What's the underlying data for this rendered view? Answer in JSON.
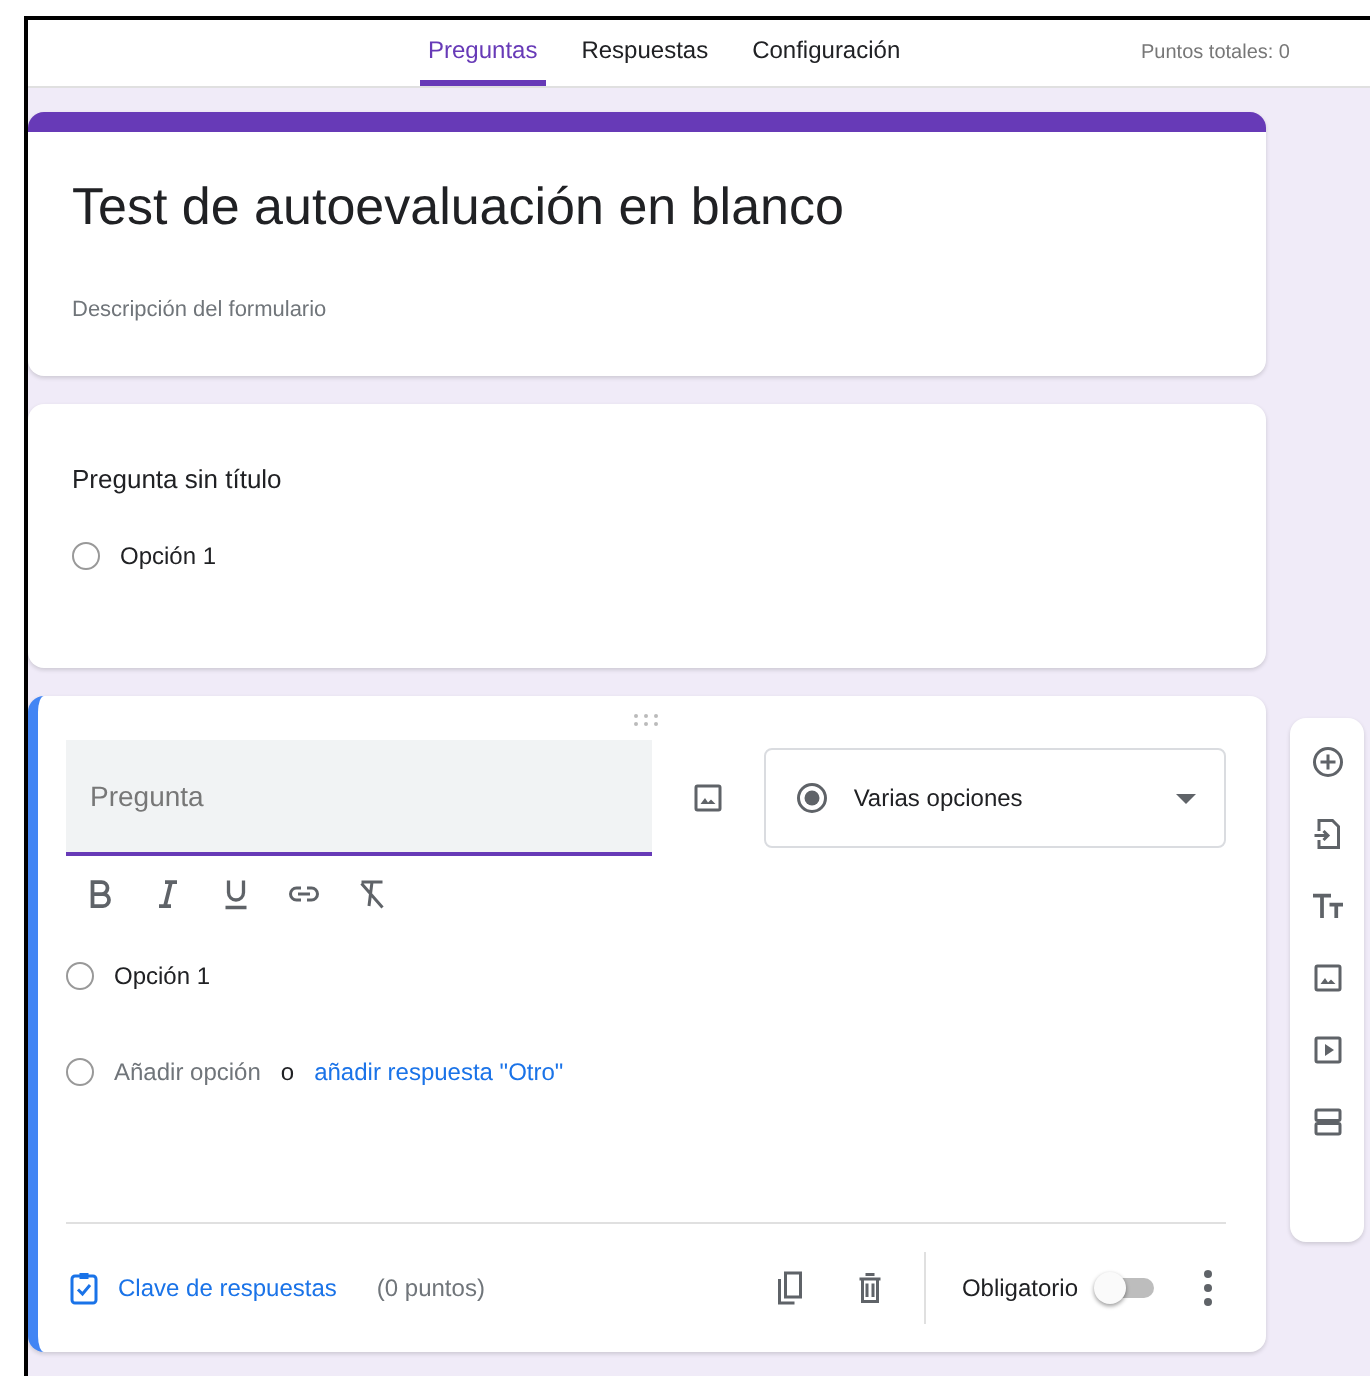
{
  "tabs": [
    {
      "label": "Preguntas",
      "selected": true
    },
    {
      "label": "Respuestas",
      "selected": false
    },
    {
      "label": "Configuración",
      "selected": false
    }
  ],
  "total_points": "Puntos totales: 0",
  "form": {
    "title": "Test de autoevaluación en blanco",
    "description": "Descripción del formulario"
  },
  "question_preview": {
    "title": "Pregunta sin título",
    "options": [
      {
        "label": "Opción 1",
        "checked": false
      }
    ]
  },
  "editor": {
    "question_placeholder": "Pregunta",
    "question_type": "Varias opciones",
    "options": [
      {
        "label": "Opción 1",
        "checked": false
      }
    ],
    "add_option": {
      "label": "Añadir opción",
      "checked": false
    },
    "or": "o",
    "add_other": "añadir respuesta \"Otro\"",
    "answer_key": "Clave de respuestas",
    "points": "(0 puntos)",
    "required_label": "Obligatorio",
    "required": false
  }
}
